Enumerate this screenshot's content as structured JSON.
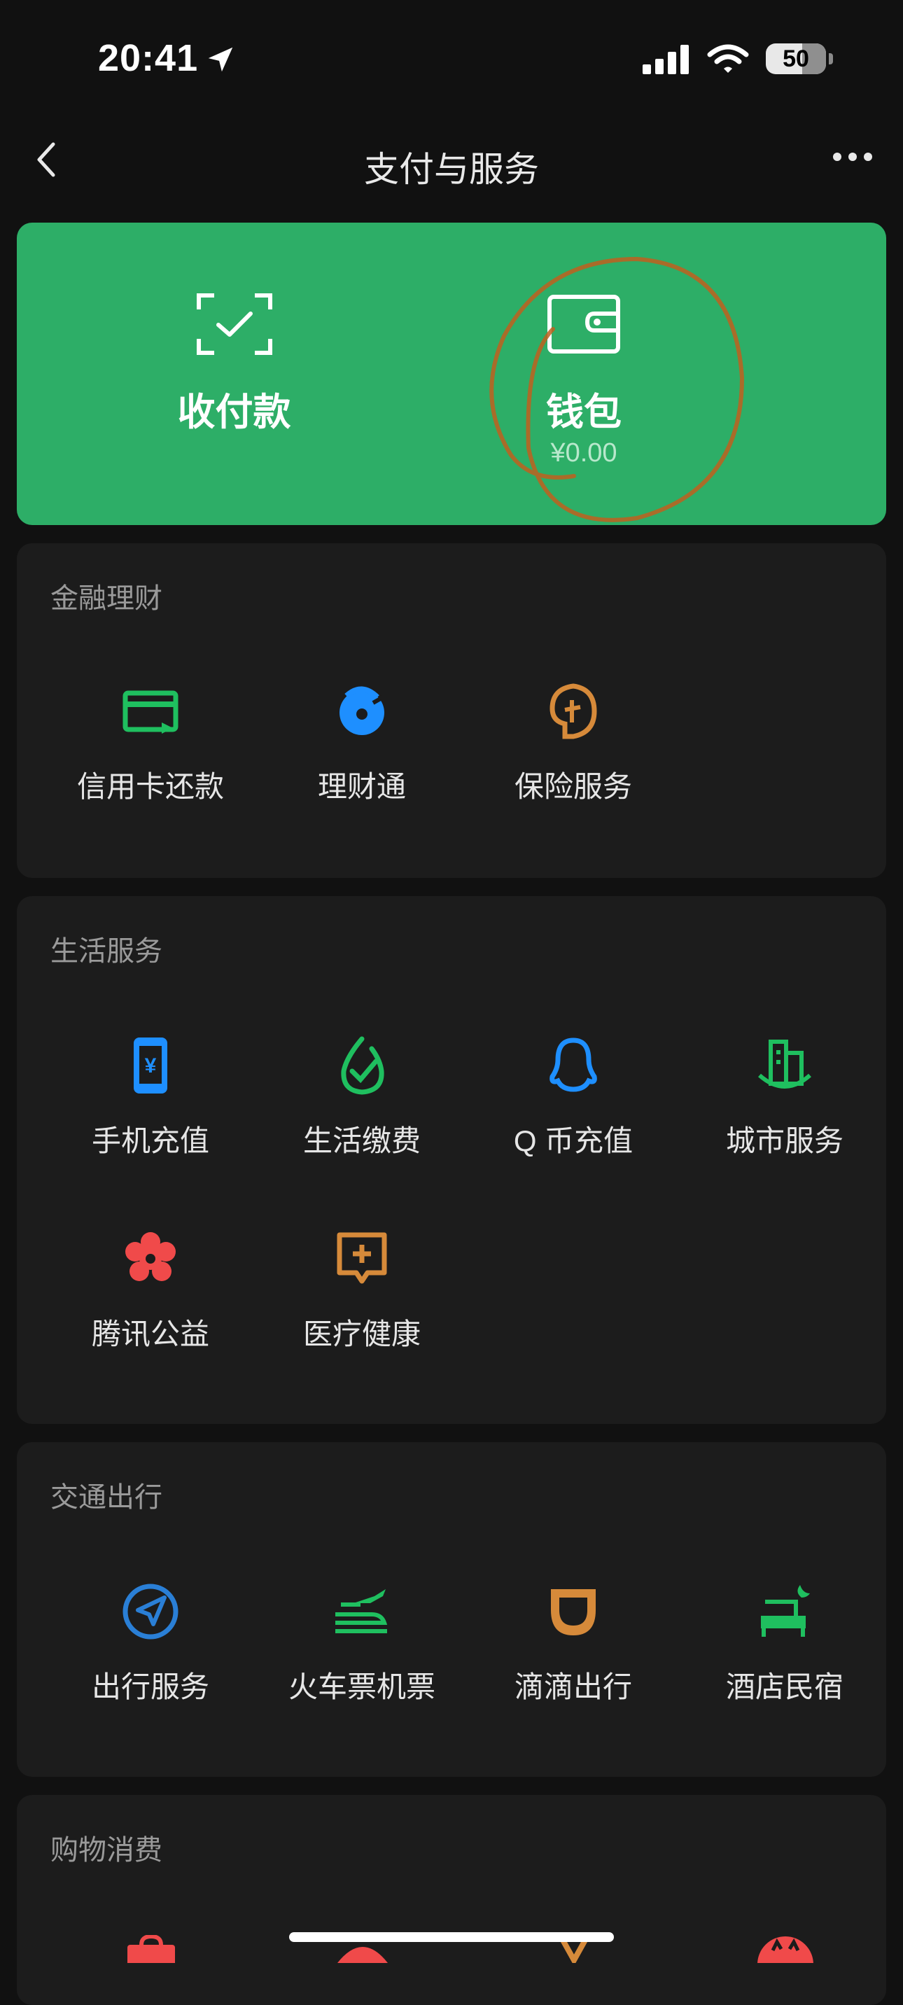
{
  "status_bar": {
    "time": "20:41",
    "battery": "50"
  },
  "nav": {
    "title": "支付与服务"
  },
  "hero": {
    "pay": {
      "label": "收付款"
    },
    "wallet": {
      "label": "钱包",
      "balance": "¥0.00"
    }
  },
  "sections": {
    "finance": {
      "title": "金融理财",
      "items": [
        "信用卡还款",
        "理财通",
        "保险服务"
      ]
    },
    "life": {
      "title": "生活服务",
      "items": [
        "手机充值",
        "生活缴费",
        "Q 币充值",
        "城市服务",
        "腾讯公益",
        "医疗健康"
      ]
    },
    "travel": {
      "title": "交通出行",
      "items": [
        "出行服务",
        "火车票机票",
        "滴滴出行",
        "酒店民宿"
      ]
    },
    "shopping": {
      "title": "购物消费"
    }
  },
  "colors": {
    "hero_green": "#2dae67",
    "icon_green": "#1fbf5f",
    "icon_blue": "#1e8fff",
    "icon_orange": "#d68a3a",
    "icon_red": "#f04a4a"
  },
  "icons": {
    "finance": [
      "credit-card-icon",
      "licaitong-icon",
      "insurance-icon"
    ],
    "life": [
      "mobile-topup-icon",
      "utility-bill-icon",
      "qq-coin-icon",
      "city-service-icon",
      "charity-icon",
      "medical-icon"
    ],
    "travel": [
      "travel-service-icon",
      "train-plane-icon",
      "didi-icon",
      "hotel-icon"
    ]
  }
}
